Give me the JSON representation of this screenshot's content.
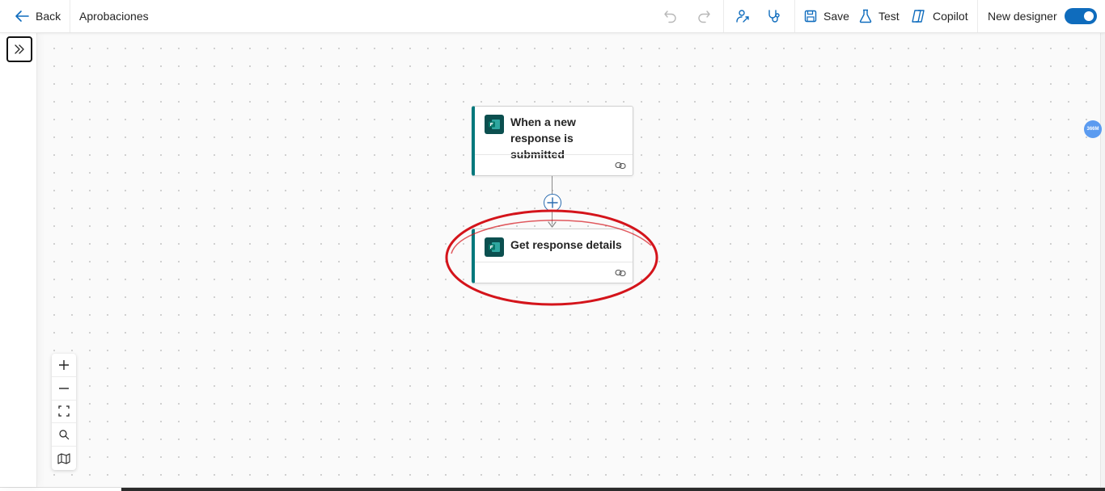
{
  "toolbar": {
    "back_label": "Back",
    "flow_name": "Aprobaciones",
    "save_label": "Save",
    "test_label": "Test",
    "copilot_label": "Copilot",
    "new_designer_label": "New designer",
    "new_designer_enabled": true
  },
  "flow": {
    "trigger": {
      "title": "When a new response is submitted",
      "icon": "forms-icon"
    },
    "action": {
      "title": "Get response details",
      "icon": "forms-icon"
    }
  },
  "zoom_controls": [
    "zoom-in",
    "zoom-out",
    "fit-view",
    "search",
    "minimap"
  ],
  "perf_badge": "366M",
  "colors": {
    "accent": "#0f6cbd",
    "card_border": "#03787c",
    "forms_icon_bg": "#0b4f4f",
    "highlight": "#d4141b"
  }
}
